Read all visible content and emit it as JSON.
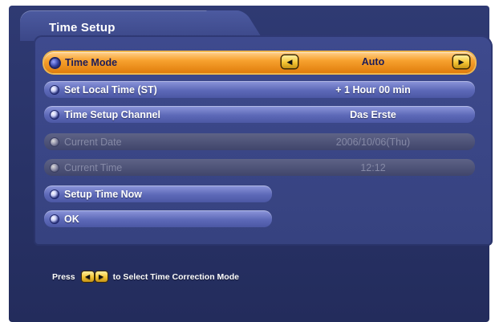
{
  "title": "Time Setup",
  "menu": [
    {
      "label": "Time Mode",
      "value": "Auto",
      "state": "selected"
    },
    {
      "label": "Set Local Time (ST)",
      "value": "+ 1 Hour 00 min",
      "state": "normal"
    },
    {
      "label": "Time Setup Channel",
      "value": "Das Erste",
      "state": "normal"
    },
    {
      "label": "Current Date",
      "value": "2006/10/06(Thu)",
      "state": "disabled"
    },
    {
      "label": "Current Time",
      "value": "12:12",
      "state": "disabled"
    },
    {
      "label": "Setup Time Now",
      "value": "",
      "state": "normal"
    },
    {
      "label": "OK",
      "value": "",
      "state": "normal"
    }
  ],
  "arrows": {
    "left": "◀",
    "right": "▶"
  },
  "footer": {
    "press": "Press",
    "hint": "to Select Time Correction Mode"
  },
  "colors": {
    "selected_highlight": "#f7a12e",
    "panel": "#3e4a8e",
    "background": "#283266"
  }
}
